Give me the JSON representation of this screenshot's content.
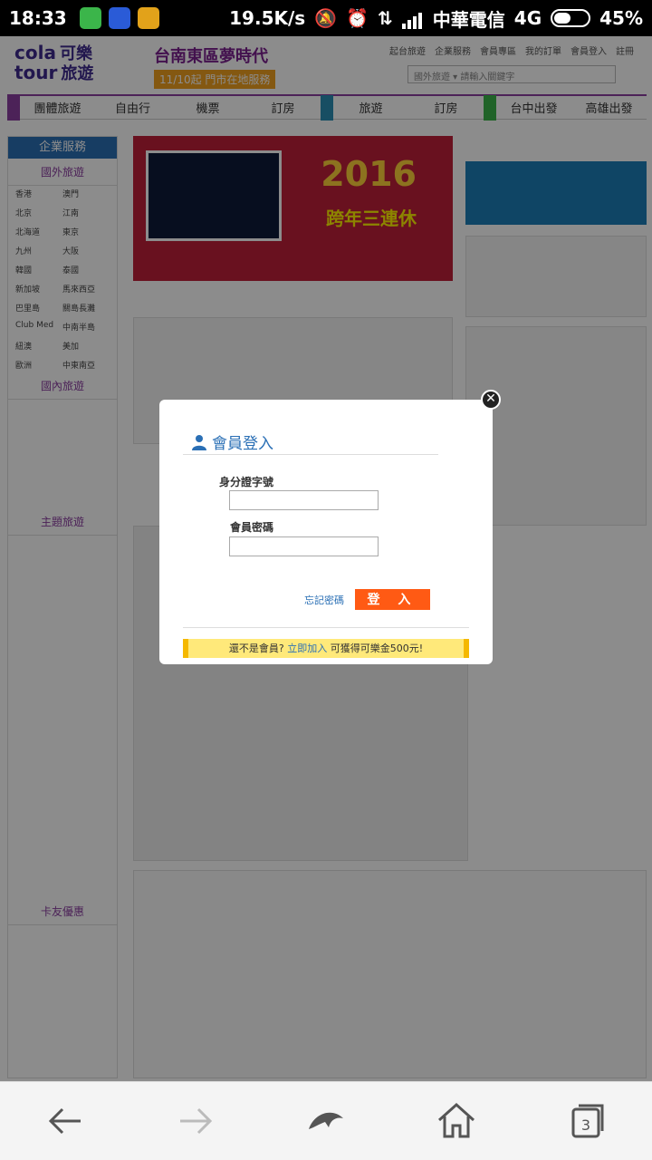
{
  "status_bar": {
    "time": "18:33",
    "network_speed": "19.5K/s",
    "carrier": "中華電信",
    "network_type": "4G",
    "battery": "45%"
  },
  "site": {
    "logo_en_1": "cola",
    "logo_en_2": "tour",
    "logo_zh_1": "可樂",
    "logo_zh_2": "旅遊",
    "promo_title": "台南東區夢時代",
    "promo_sub": "11/10起 門市在地服務",
    "top_links": [
      "起台旅遊",
      "企業服務",
      "會員專區",
      "我的訂單",
      "會員登入",
      "註冊"
    ],
    "search_placeholder": "國外旅遊 ▾  請輸入關鍵字",
    "nav_items": [
      "團體旅遊",
      "自由行",
      "機票",
      "訂房",
      "旅遊",
      "訂房",
      "台中出發",
      "高雄出發"
    ],
    "sidebar_head": "企業服務",
    "sidebar_sections": [
      "國外旅遊",
      "國內旅遊",
      "主題旅遊",
      "卡友優惠"
    ],
    "sidebar_places": [
      "香港",
      "澳門",
      "北京",
      "江南",
      "北海道",
      "東京",
      "九州",
      "大阪",
      "韓國",
      "泰國",
      "新加坡",
      "馬來西亞",
      "巴里島",
      "關島長灘",
      "Club Med",
      "中南半島",
      "紐澳",
      "美加",
      "歐洲",
      "中東南亞"
    ],
    "banner_year": "2016",
    "banner_sub": "跨年三連休"
  },
  "modal": {
    "title": "會員登入",
    "id_label": "身分證字號",
    "id_value": "",
    "password_label": "會員密碼",
    "password_value": "",
    "forgot_label": "忘記密碼",
    "login_button": "登 入",
    "member_prompt_1": "還不是會員?",
    "member_prompt_link": "立即加入",
    "member_prompt_2": "可獲得可樂金500元!"
  },
  "colors": {
    "accent_purple": "#8a3ea0",
    "link_blue": "#2a6fb5",
    "login_orange": "#ff5a14",
    "member_bar_yellow": "#ffe97a"
  },
  "bottom_nav": {
    "tab_count": "3"
  }
}
